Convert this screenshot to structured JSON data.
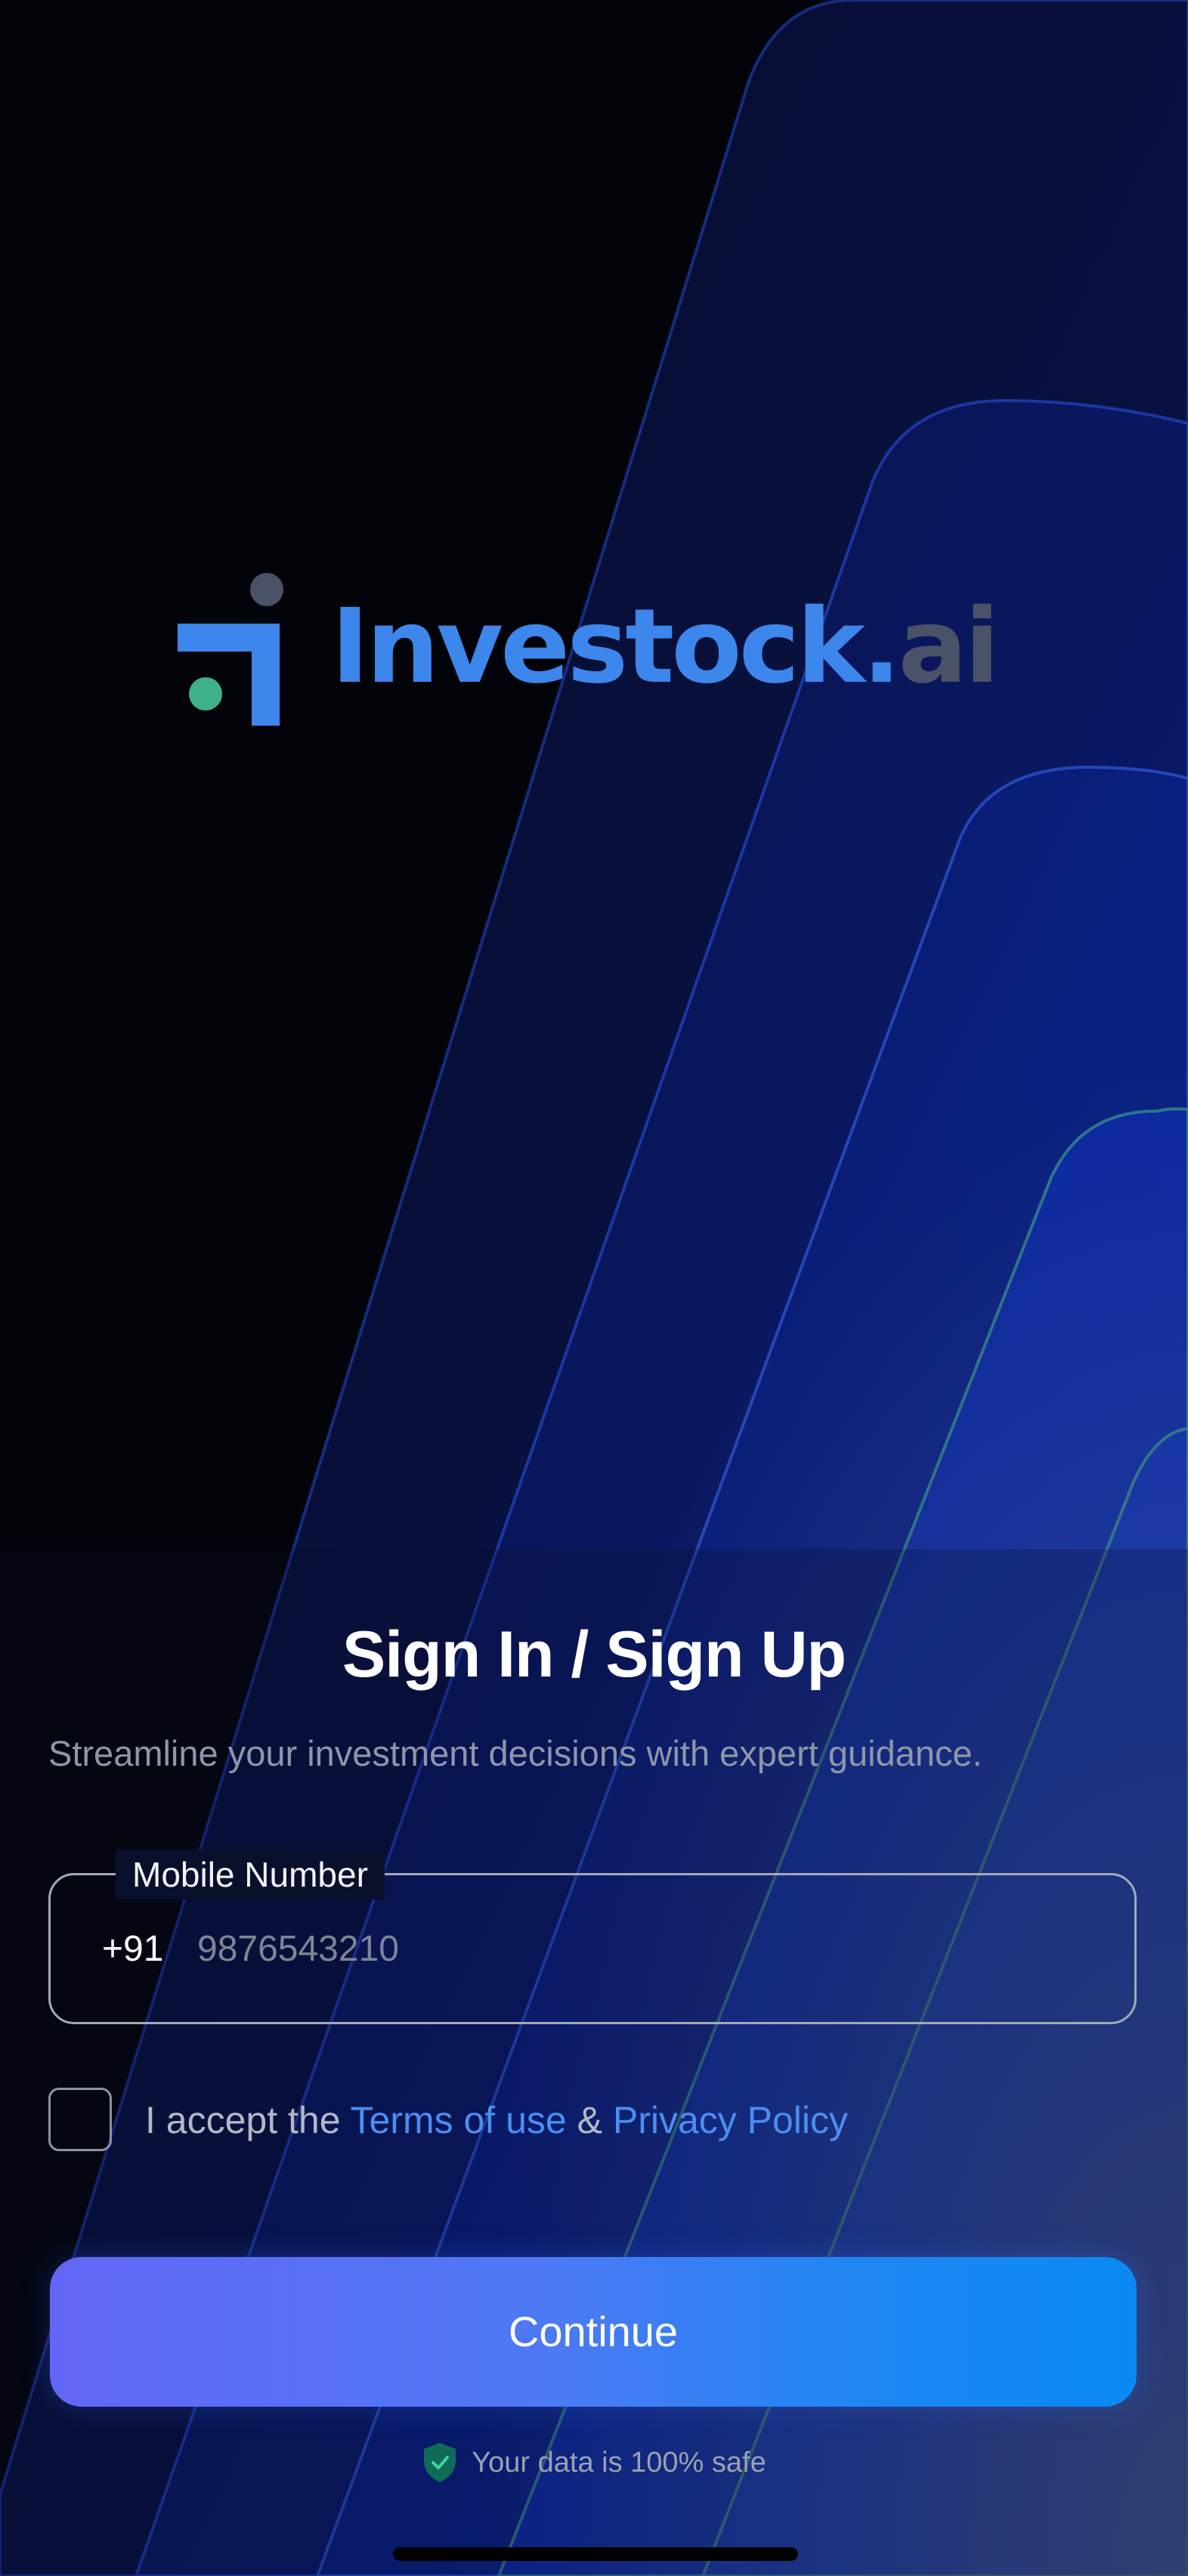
{
  "brand": {
    "name": "Investock",
    "dot": ".",
    "tld": "ai",
    "colors": {
      "primary_blue": "#3d86ec",
      "green_dot": "#3fb28a",
      "gray": "#4a5268"
    }
  },
  "auth": {
    "title": "Sign In / Sign Up",
    "subtitle": "Streamline your investment decisions with expert guidance.",
    "mobile_field": {
      "label": "Mobile Number",
      "country_code": "+91",
      "placeholder": "9876543210"
    },
    "terms": {
      "prefix": "I accept the ",
      "terms_link": "Terms of use",
      "separator": " & ",
      "privacy_link": "Privacy Policy"
    },
    "continue_label": "Continue",
    "safe_text": "Your data is 100% safe"
  },
  "icons": {
    "logo": "investock-logo-mark-icon",
    "checkbox": "checkbox-empty",
    "shield": "shield-check-icon"
  }
}
